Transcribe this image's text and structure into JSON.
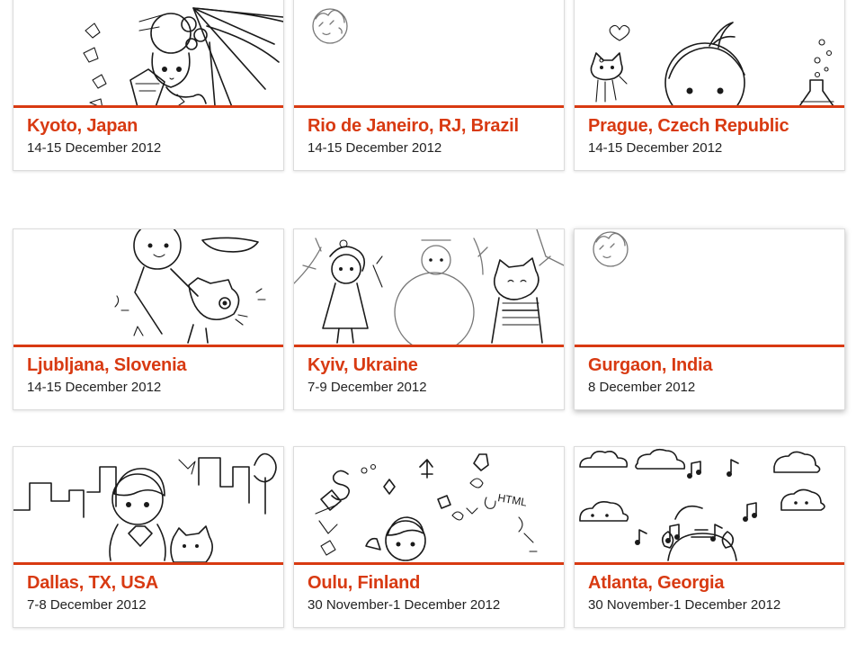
{
  "accent_color": "#d83a12",
  "events": [
    {
      "city": "Kyoto, Japan",
      "date": "14-15 December 2012",
      "illustration": "geisha-with-umbrella-illustration"
    },
    {
      "city": "Rio de Janeiro, RJ, Brazil",
      "date": "14-15 December 2012",
      "illustration": "placeholder-face-illustration"
    },
    {
      "city": "Prague, Czech Republic",
      "date": "14-15 December 2012",
      "illustration": "girl-with-cat-and-flask-illustration"
    },
    {
      "city": "Ljubljana, Slovenia",
      "date": "14-15 December 2012",
      "illustration": "girl-with-dragon-illustration"
    },
    {
      "city": "Kyiv, Ukraine",
      "date": "7-9 December 2012",
      "illustration": "girl-snowman-and-cat-illustration"
    },
    {
      "city": "Gurgaon, India",
      "date": "8 December 2012",
      "illustration": "placeholder-face-illustration"
    },
    {
      "city": "Dallas, TX, USA",
      "date": "7-8 December 2012",
      "illustration": "boy-city-skyline-illustration"
    },
    {
      "city": "Oulu, Finland",
      "date": "30 November-1 December 2012",
      "illustration": "girl-with-doodles-illustration"
    },
    {
      "city": "Atlanta, Georgia",
      "date": "30 November-1 December 2012",
      "illustration": "clouds-and-music-notes-illustration"
    }
  ]
}
